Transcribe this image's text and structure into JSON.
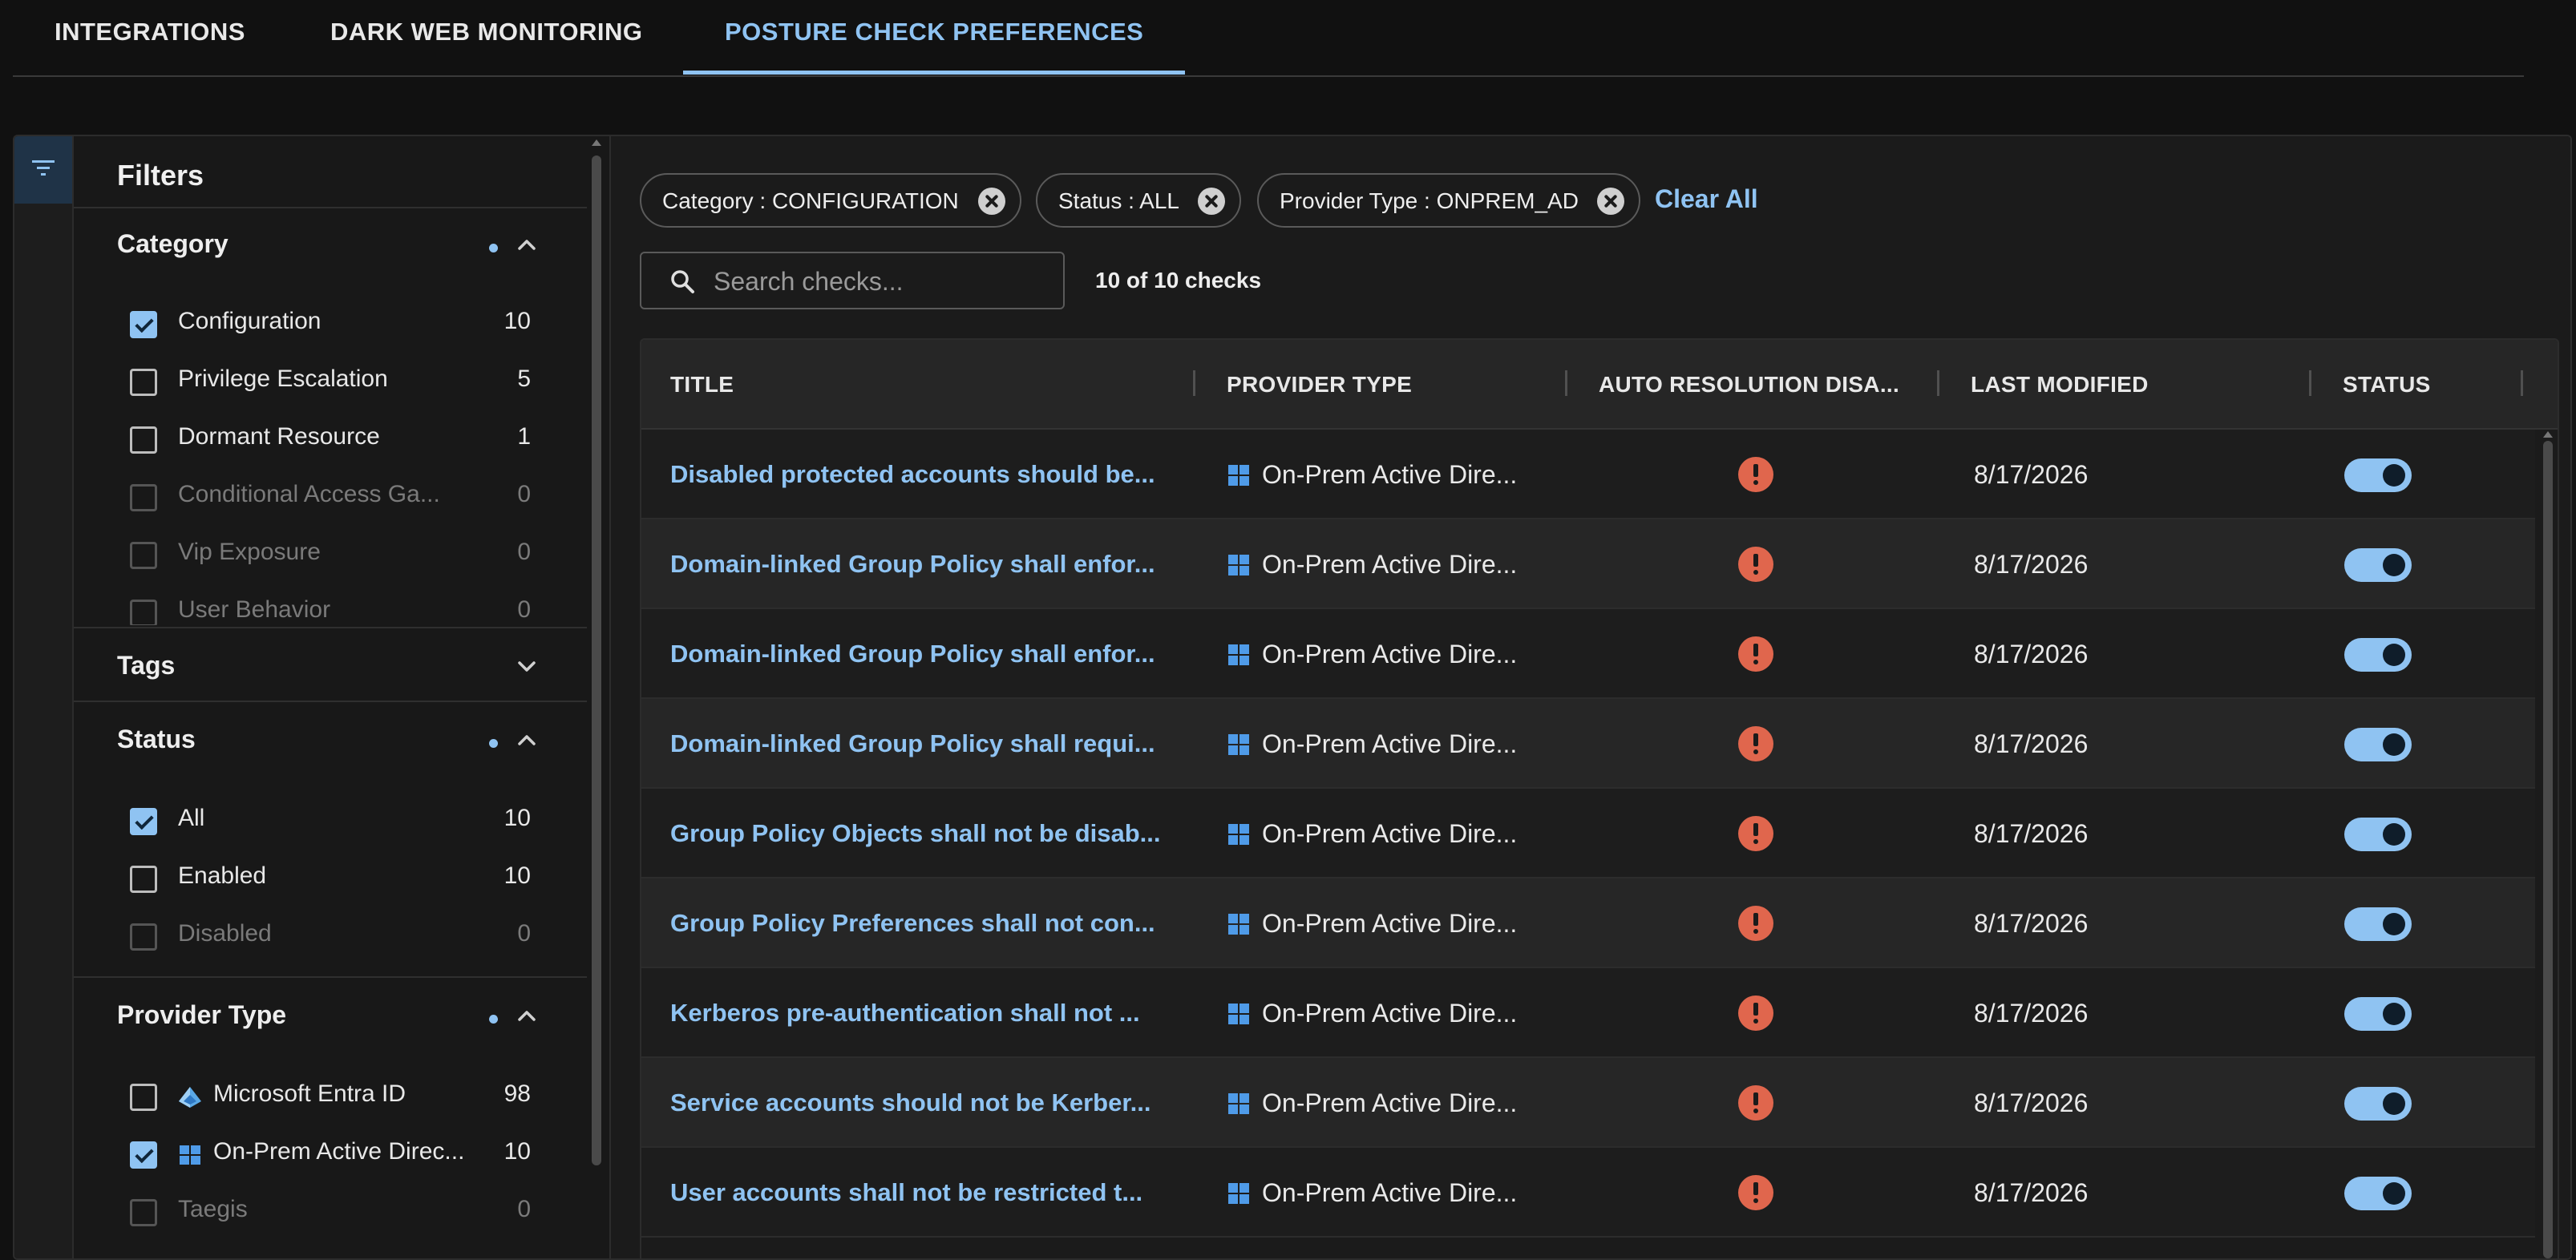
{
  "tabs": [
    {
      "label": "INTEGRATIONS",
      "active": false
    },
    {
      "label": "DARK WEB MONITORING",
      "active": false
    },
    {
      "label": "POSTURE CHECK PREFERENCES",
      "active": true
    }
  ],
  "filters": {
    "title": "Filters",
    "category": {
      "title": "Category",
      "options": [
        {
          "label": "Configuration",
          "count": "10",
          "checked": true,
          "dim": false
        },
        {
          "label": "Privilege Escalation",
          "count": "5",
          "checked": false,
          "dim": false
        },
        {
          "label": "Dormant Resource",
          "count": "1",
          "checked": false,
          "dim": false
        },
        {
          "label": "Conditional Access Ga...",
          "count": "0",
          "checked": false,
          "dim": true
        },
        {
          "label": "Vip Exposure",
          "count": "0",
          "checked": false,
          "dim": true
        },
        {
          "label": "User Behavior",
          "count": "0",
          "checked": false,
          "dim": true
        }
      ]
    },
    "tags": {
      "title": "Tags"
    },
    "status": {
      "title": "Status",
      "options": [
        {
          "label": "All",
          "count": "10",
          "checked": true,
          "dim": false
        },
        {
          "label": "Enabled",
          "count": "10",
          "checked": false,
          "dim": false
        },
        {
          "label": "Disabled",
          "count": "0",
          "checked": false,
          "dim": true
        }
      ]
    },
    "provider_type": {
      "title": "Provider Type",
      "options": [
        {
          "label": "Microsoft Entra ID",
          "count": "98",
          "checked": false,
          "dim": false,
          "icon": "entra-id-icon"
        },
        {
          "label": "On-Prem Active Direc...",
          "count": "10",
          "checked": true,
          "dim": false,
          "icon": "windows-icon"
        },
        {
          "label": "Taegis",
          "count": "0",
          "checked": false,
          "dim": true
        }
      ]
    }
  },
  "chips": [
    {
      "label": "Category : CONFIGURATION"
    },
    {
      "label": "Status : ALL"
    },
    {
      "label": "Provider Type : ONPREM_AD"
    }
  ],
  "clear_all": "Clear All",
  "search": {
    "placeholder": "Search checks...",
    "value": ""
  },
  "results_count": "10 of 10 checks",
  "table": {
    "columns": [
      "TITLE",
      "PROVIDER TYPE",
      "AUTO RESOLUTION DISA...",
      "LAST MODIFIED",
      "STATUS"
    ],
    "rows": [
      {
        "title": "Disabled protected accounts should be...",
        "provider": "On-Prem Active Dire...",
        "date": "8/17/2026",
        "enabled": true
      },
      {
        "title": "Domain-linked Group Policy shall enfor...",
        "provider": "On-Prem Active Dire...",
        "date": "8/17/2026",
        "enabled": true
      },
      {
        "title": "Domain-linked Group Policy shall enfor...",
        "provider": "On-Prem Active Dire...",
        "date": "8/17/2026",
        "enabled": true
      },
      {
        "title": "Domain-linked Group Policy shall requi...",
        "provider": "On-Prem Active Dire...",
        "date": "8/17/2026",
        "enabled": true
      },
      {
        "title": "Group Policy Objects shall not be disab...",
        "provider": "On-Prem Active Dire...",
        "date": "8/17/2026",
        "enabled": true
      },
      {
        "title": "Group Policy Preferences shall not con...",
        "provider": "On-Prem Active Dire...",
        "date": "8/17/2026",
        "enabled": true
      },
      {
        "title": "Kerberos pre-authentication shall not ...",
        "provider": "On-Prem Active Dire...",
        "date": "8/17/2026",
        "enabled": true
      },
      {
        "title": "Service accounts should not be Kerber...",
        "provider": "On-Prem Active Dire...",
        "date": "8/17/2026",
        "enabled": true
      },
      {
        "title": "User accounts shall not be restricted t...",
        "provider": "On-Prem Active Dire...",
        "date": "8/17/2026",
        "enabled": true
      }
    ]
  },
  "colors": {
    "accent": "#8fc3f2",
    "warning": "#e0664d",
    "background": "#111111"
  }
}
